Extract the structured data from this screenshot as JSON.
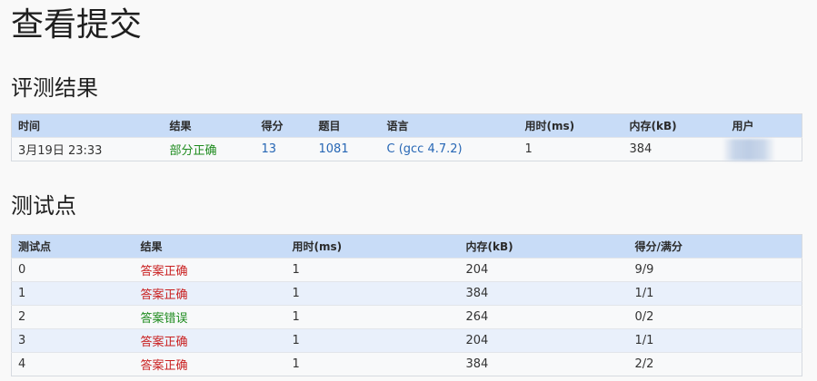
{
  "page": {
    "title": "查看提交"
  },
  "colors": {
    "header_bg": "#c8dcf7",
    "row_bg": "#f8f9fa",
    "row_alt_bg": "#e9f0fb",
    "link": "#2767b5",
    "red": "#c91f1f",
    "green": "#1e8b1e"
  },
  "result_section": {
    "heading": "评测结果",
    "columns": [
      "时间",
      "结果",
      "得分",
      "题目",
      "语言",
      "用时(ms)",
      "内存(kB)",
      "用户"
    ],
    "row": {
      "time": "3月19日 23:33",
      "result": "部分正确",
      "result_color": "#1e8b1e",
      "score": "13",
      "problem": "1081",
      "language": "C (gcc 4.7.2)",
      "time_ms": "1",
      "memory_kb": "384"
    }
  },
  "testcase_section": {
    "heading": "测试点",
    "columns": [
      "测试点",
      "结果",
      "用时(ms)",
      "内存(kB)",
      "得分/满分"
    ],
    "rows": [
      {
        "case": "0",
        "result": "答案正确",
        "result_color": "#c91f1f",
        "time_ms": "1",
        "memory_kb": "204",
        "score": "9/9"
      },
      {
        "case": "1",
        "result": "答案正确",
        "result_color": "#c91f1f",
        "time_ms": "1",
        "memory_kb": "384",
        "score": "1/1"
      },
      {
        "case": "2",
        "result": "答案错误",
        "result_color": "#1e8b1e",
        "time_ms": "1",
        "memory_kb": "264",
        "score": "0/2"
      },
      {
        "case": "3",
        "result": "答案正确",
        "result_color": "#c91f1f",
        "time_ms": "1",
        "memory_kb": "204",
        "score": "1/1"
      },
      {
        "case": "4",
        "result": "答案正确",
        "result_color": "#c91f1f",
        "time_ms": "1",
        "memory_kb": "384",
        "score": "2/2"
      }
    ]
  }
}
